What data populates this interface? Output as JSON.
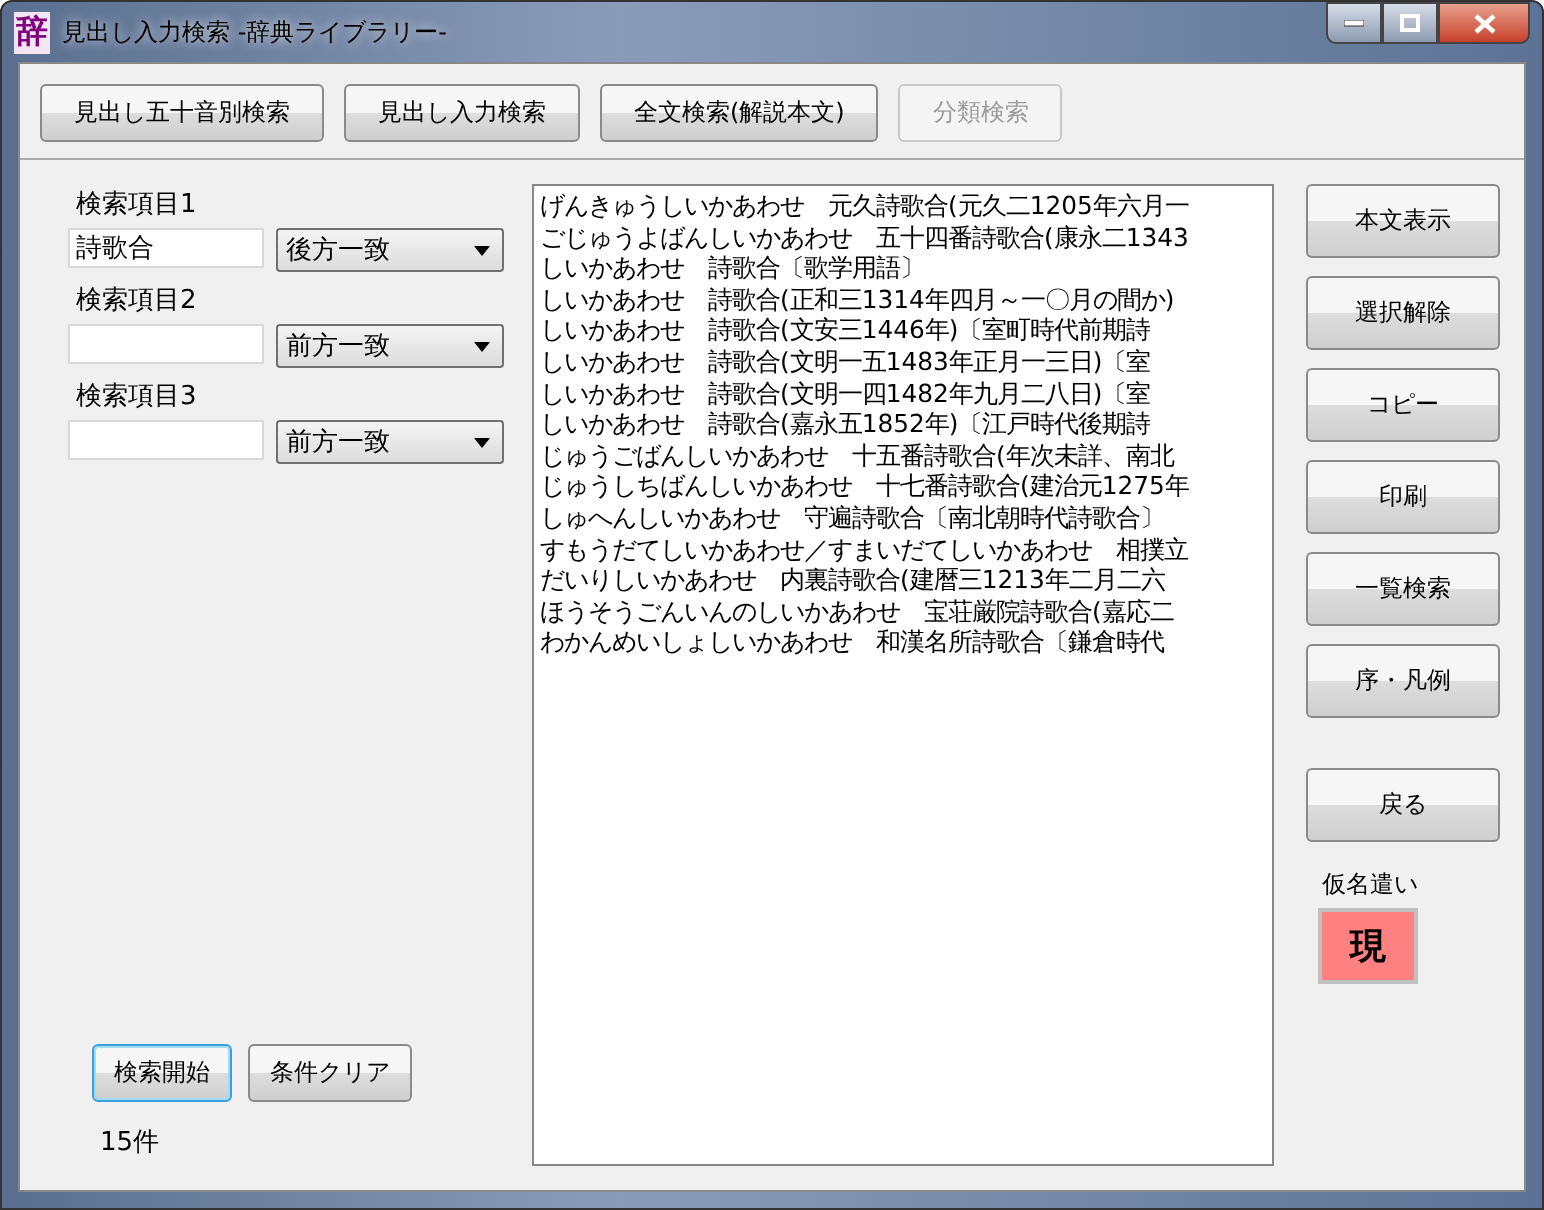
{
  "window": {
    "icon": "辞",
    "title": "見出し入力検索 -辞典ライブラリー-"
  },
  "toolbar": [
    {
      "label": "見出し五十音別検索",
      "disabled": false
    },
    {
      "label": "見出し入力検索",
      "disabled": false
    },
    {
      "label": "全文検索(解説本文)",
      "disabled": false
    },
    {
      "label": "分類検索",
      "disabled": true
    }
  ],
  "search_items": [
    {
      "label": "検索項目1",
      "value": "詩歌合",
      "match": "後方一致"
    },
    {
      "label": "検索項目2",
      "value": "",
      "match": "前方一致"
    },
    {
      "label": "検索項目3",
      "value": "",
      "match": "前方一致"
    }
  ],
  "actions": [
    {
      "label": "検索開始",
      "focused": true
    },
    {
      "label": "条件クリア",
      "focused": false
    }
  ],
  "result_count": "15件",
  "results": [
    "げんきゅうしいかあわせ　元久詩歌合(元久二1205年六月一",
    "ごじゅうよばんしいかあわせ　五十四番詩歌合(康永二1343",
    "しいかあわせ　詩歌合〔歌学用語〕",
    "しいかあわせ　詩歌合(正和三1314年四月～一〇月の間か)",
    "しいかあわせ　詩歌合(文安三1446年)〔室町時代前期詩",
    "しいかあわせ　詩歌合(文明一五1483年正月一三日)〔室",
    "しいかあわせ　詩歌合(文明一四1482年九月二八日)〔室",
    "しいかあわせ　詩歌合(嘉永五1852年)〔江戸時代後期詩",
    "じゅうごばんしいかあわせ　十五番詩歌合(年次未詳、南北",
    "じゅうしちばんしいかあわせ　十七番詩歌合(建治元1275年",
    "しゅへんしいかあわせ　守遍詩歌合〔南北朝時代詩歌合〕",
    "すもうだてしいかあわせ／すまいだてしいかあわせ　相撲立",
    "だいりしいかあわせ　内裏詩歌合(建暦三1213年二月二六",
    "ほうそうごんいんのしいかあわせ　宝荘厳院詩歌合(嘉応二",
    "わかんめいしょしいかあわせ　和漢名所詩歌合〔鎌倉時代"
  ],
  "side_buttons": [
    {
      "label": "本文表示",
      "kind": "button"
    },
    {
      "label": "選択解除",
      "kind": "button"
    },
    {
      "label": "コピー",
      "kind": "button"
    },
    {
      "label": "印刷",
      "kind": "button"
    },
    {
      "label": "一覧検索",
      "kind": "button"
    },
    {
      "label": "序・凡例",
      "kind": "button"
    },
    {
      "label": "戻る",
      "kind": "spaced"
    }
  ],
  "kana": {
    "label": "仮名遣い",
    "value": "現"
  }
}
